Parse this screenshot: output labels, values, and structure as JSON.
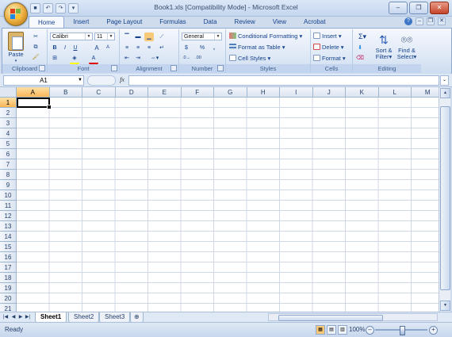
{
  "window": {
    "title": "Book1.xls  [Compatibility Mode] - Microsoft Excel"
  },
  "ribbon_tabs": [
    {
      "label": "Home",
      "active": true
    },
    {
      "label": "Insert"
    },
    {
      "label": "Page Layout"
    },
    {
      "label": "Formulas"
    },
    {
      "label": "Data"
    },
    {
      "label": "Review"
    },
    {
      "label": "View"
    },
    {
      "label": "Acrobat"
    }
  ],
  "clipboard": {
    "paste_label": "Paste",
    "group_label": "Clipboard"
  },
  "font": {
    "name": "Calibri",
    "size": "11",
    "bold": "B",
    "italic": "I",
    "underline": "U",
    "grow": "A",
    "shrink": "A",
    "font_color": "A",
    "group_label": "Font"
  },
  "alignment": {
    "group_label": "Alignment"
  },
  "number": {
    "format": "General",
    "currency": "$",
    "percent": "%",
    "comma": ",",
    "group_label": "Number"
  },
  "styles": {
    "conditional": "Conditional Formatting",
    "format_table": "Format as Table",
    "cell_styles": "Cell Styles",
    "group_label": "Styles"
  },
  "cells": {
    "insert": "Insert",
    "delete": "Delete",
    "format": "Format",
    "group_label": "Cells"
  },
  "editing": {
    "sigma": "Σ",
    "sort_filter_1": "Sort &",
    "sort_filter_2": "Filter",
    "find_select_1": "Find &",
    "find_select_2": "Select",
    "group_label": "Editing"
  },
  "formula_bar": {
    "name_box": "A1",
    "fx": "fx",
    "value": ""
  },
  "columns": [
    "A",
    "B",
    "C",
    "D",
    "E",
    "F",
    "G",
    "H",
    "I",
    "J",
    "K",
    "L",
    "M"
  ],
  "rows": [
    "1",
    "2",
    "3",
    "4",
    "5",
    "6",
    "7",
    "8",
    "9",
    "10",
    "11",
    "12",
    "13",
    "14",
    "15",
    "16",
    "17",
    "18",
    "19",
    "20",
    "21"
  ],
  "sheets": [
    {
      "label": "Sheet1",
      "active": true
    },
    {
      "label": "Sheet2"
    },
    {
      "label": "Sheet3"
    }
  ],
  "status": {
    "text": "Ready",
    "zoom": "100%"
  }
}
